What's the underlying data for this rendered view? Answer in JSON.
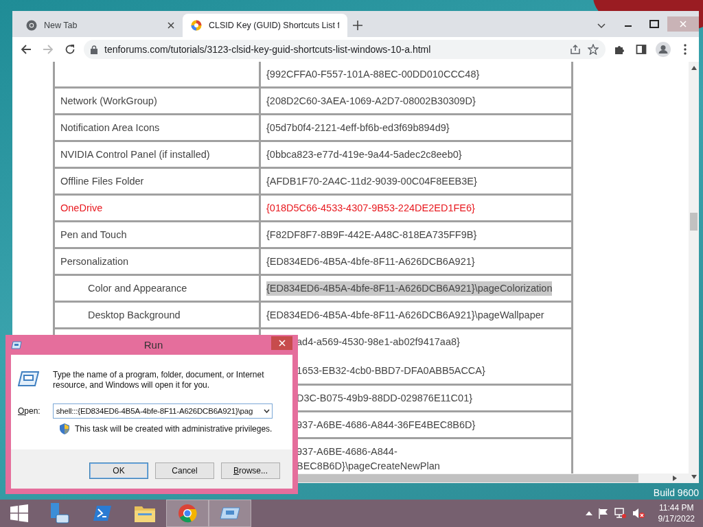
{
  "desktop": {
    "watermark": "Build 9600"
  },
  "browser": {
    "tabs": [
      {
        "title": "New Tab",
        "selected": false
      },
      {
        "title": "CLSID Key (GUID) Shortcuts List f",
        "selected": true
      }
    ],
    "address": "tenforums.com/tutorials/3123-clsid-key-guid-shortcuts-list-windows-10-a.html",
    "table": {
      "rows": [
        {
          "lines": [
            "{992CFFA0-F557-101A-88EC-00DD010CCC48}"
          ],
          "color": "#444444",
          "highlighted": false
        },
        {
          "name": "Network (WorkGroup)",
          "lines": [
            "{208D2C60-3AEA-1069-A2D7-08002B30309D}"
          ],
          "color": "#444444",
          "highlighted": false
        },
        {
          "name": "Notification Area Icons",
          "lines": [
            "{05d7b0f4-2121-4eff-bf6b-ed3f69b894d9}"
          ],
          "color": "#444444",
          "highlighted": false
        },
        {
          "name": "NVIDIA Control Panel (if installed)",
          "lines": [
            "{0bbca823-e77d-419e-9a44-5adec2c8eeb0}"
          ],
          "color": "#444444",
          "highlighted": false
        },
        {
          "name": "Offline Files Folder",
          "lines": [
            "{AFDB1F70-2A4C-11d2-9039-00C04F8EEB3E}"
          ],
          "color": "#444444",
          "highlighted": false
        },
        {
          "name": "OneDrive",
          "lines": [
            "{018D5C66-4533-4307-9B53-224DE2ED1FE6}"
          ],
          "color": "#e8191f",
          "highlighted": false
        },
        {
          "name": "Pen and Touch",
          "lines": [
            "{F82DF8F7-8B9F-442E-A48C-818EA735FF9B}"
          ],
          "color": "#444444",
          "highlighted": false
        },
        {
          "name": "Personalization",
          "lines": [
            "{ED834ED6-4B5A-4bfe-8F11-A626DCB6A921}"
          ],
          "color": "#444444",
          "highlighted": false,
          "children": [
            {
              "name": "Color and Appearance",
              "lines": [
                "{ED834ED6-4B5A-4bfe-8F11-A626DCB6A921}\\pageColorization"
              ],
              "color": "#444444",
              "highlighted": true
            },
            {
              "name": "Desktop Background",
              "lines": [
                "{ED834ED6-4B5A-4bfe-8F11-A626DCB6A921}\\pageWallpaper"
              ],
              "color": "#444444",
              "highlighted": false
            }
          ]
        }
      ],
      "rows_behind_dialog": [
        {
          "lines": [
            "ad4-a569-4530-98e1-ab02f9417aa8}",
            "1653-EB32-4cb0-BBD7-DFA0ABB5ACCA}"
          ],
          "color": "#444444",
          "highlighted": false
        },
        {
          "lines": [
            "D3C-B075-49b9-88DD-029876E11C01}"
          ],
          "color": "#444444",
          "highlighted": false
        },
        {
          "lines": [
            "937-A6BE-4686-A844-36FE4BEC8B6D}"
          ],
          "color": "#444444",
          "highlighted": false
        },
        {
          "lines": [
            "937-A6BE-4686-A844-",
            "BEC8B6D}\\pageCreateNewPlan"
          ],
          "color": "#444444",
          "highlighted": false
        }
      ]
    }
  },
  "run_dialog": {
    "title": "Run",
    "message": "Type the name of a program, folder, document, or Internet resource, and Windows will open it for you.",
    "open_label": "Open:",
    "value": "shell:::{ED834ED6-4B5A-4bfe-8F11-A626DCB6A921}\\pag",
    "note": "This task will be created with administrative privileges.",
    "buttons": [
      {
        "label": "OK",
        "default": true
      },
      {
        "label": "Cancel",
        "default": false
      },
      {
        "label": "Browse...",
        "default": false
      }
    ]
  },
  "taskbar": {
    "apps": [
      {
        "kind": "server-manager",
        "active": false
      },
      {
        "kind": "powershell",
        "active": false
      },
      {
        "kind": "explorer",
        "active": false
      },
      {
        "kind": "chrome",
        "active": true
      },
      {
        "kind": "run",
        "active": true
      }
    ],
    "time": "11:44 PM",
    "date": "9/17/2022"
  }
}
